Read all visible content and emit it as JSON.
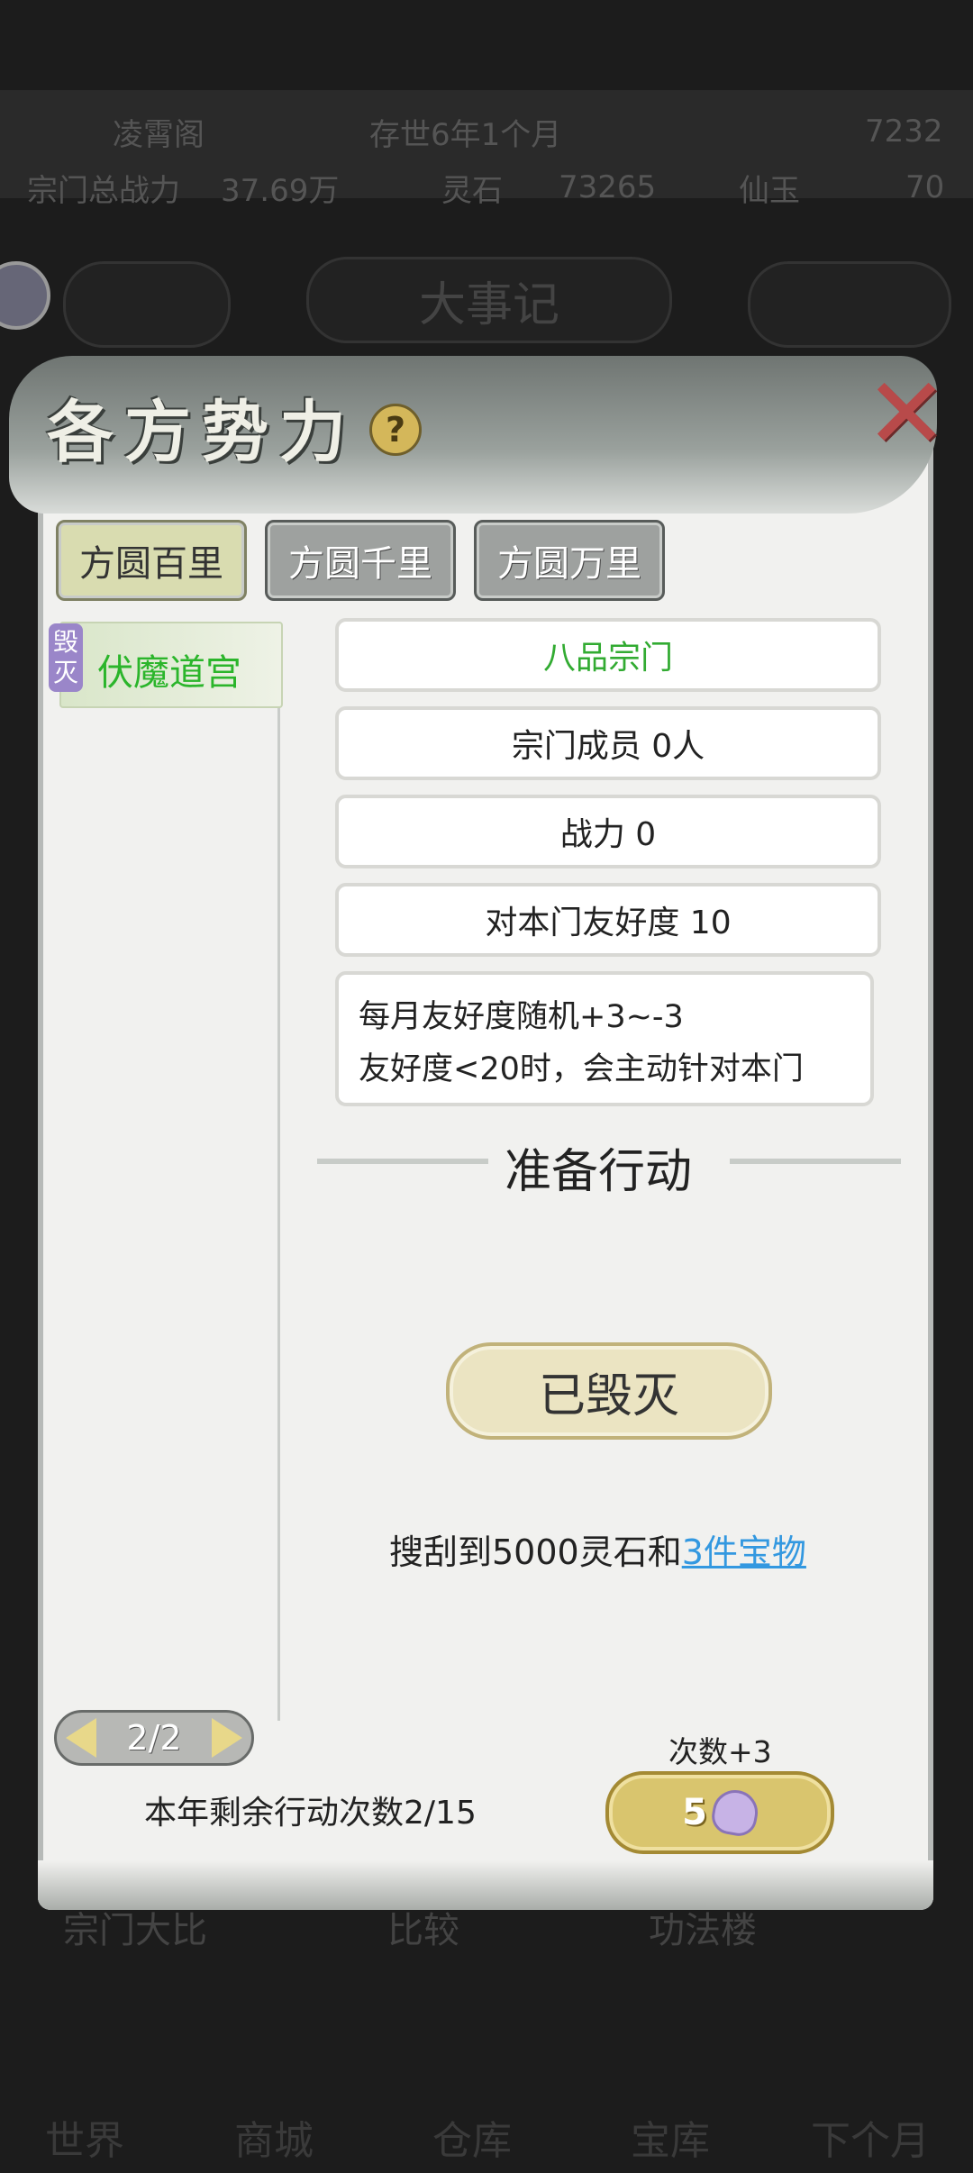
{
  "background": {
    "top_row": [
      "凌霄阁",
      "存世6年1个月",
      "7232"
    ],
    "second_row": [
      "宗门总战力",
      "37.69万",
      "灵石",
      "73265",
      "仙玉",
      "70"
    ],
    "center_pill": "大事记",
    "bottom_row": [
      "宗门大比",
      "比较",
      "功法楼"
    ],
    "nav": [
      "世界",
      "商城",
      "仓库",
      "宝库",
      "下个月"
    ]
  },
  "panel": {
    "title": "各方势力",
    "help": "?",
    "close": "✕"
  },
  "tabs": [
    {
      "label": "方圆百里",
      "active": true
    },
    {
      "label": "方圆千里",
      "active": false
    },
    {
      "label": "方圆万里",
      "active": false
    }
  ],
  "faction_list": [
    {
      "tag_line1": "毁",
      "tag_line2": "灭",
      "name": "伏魔道宫"
    }
  ],
  "details": {
    "rank": "八品宗门",
    "members": "宗门成员 0人",
    "power": "战力 0",
    "friendship": "对本门友好度 10",
    "desc_line1": "每月友好度随机+3~-3",
    "desc_line2": "友好度<20时，会主动针对本门"
  },
  "action": {
    "section_title": "准备行动",
    "status_button": "已毁灭",
    "loot_prefix": "搜刮到5000灵石和",
    "loot_link": "3件宝物"
  },
  "footer": {
    "page": "2/2",
    "remaining": "本年剩余行动次数2/15",
    "times_label": "次数+3",
    "cost": "5",
    "cost_icon": "crystal-icon"
  },
  "colors": {
    "active_faction": "#2bb52b",
    "link": "#3398e0",
    "rank": "#32ab32"
  }
}
